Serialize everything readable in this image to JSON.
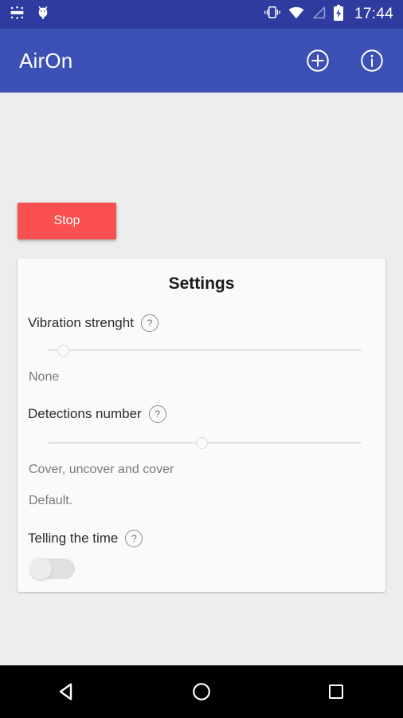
{
  "status_bar": {
    "time": "17:44",
    "notification_icons": [
      "settings-icon",
      "android-bug-icon"
    ],
    "system_icons": [
      "vibrate-icon",
      "wifi-icon",
      "signal-icon",
      "battery-charging-icon"
    ],
    "background_color": "#2f3b9e"
  },
  "app_bar": {
    "title": "AirOn",
    "background_color": "#3d50b5",
    "actions": [
      {
        "name": "add-button",
        "icon": "plus-circle-icon"
      },
      {
        "name": "info-button",
        "icon": "info-circle-icon"
      }
    ]
  },
  "main": {
    "stop_button": {
      "label": "Stop",
      "color": "#fa5050"
    },
    "settings_card": {
      "title": "Settings",
      "vibration": {
        "label": "Vibration strenght",
        "help": "?",
        "value_text": "None",
        "slider_percent": 0
      },
      "detections": {
        "label": "Detections number",
        "help": "?",
        "slider_percent": 49,
        "value_text": "Cover, uncover and cover",
        "note_text": "Default."
      },
      "telling_time": {
        "label": "Telling the time",
        "help": "?",
        "enabled": "off"
      }
    }
  },
  "nav_bar": {
    "buttons": [
      {
        "name": "back-button",
        "icon": "back-triangle-icon"
      },
      {
        "name": "home-button",
        "icon": "home-circle-icon"
      },
      {
        "name": "recents-button",
        "icon": "recents-square-icon"
      }
    ]
  }
}
